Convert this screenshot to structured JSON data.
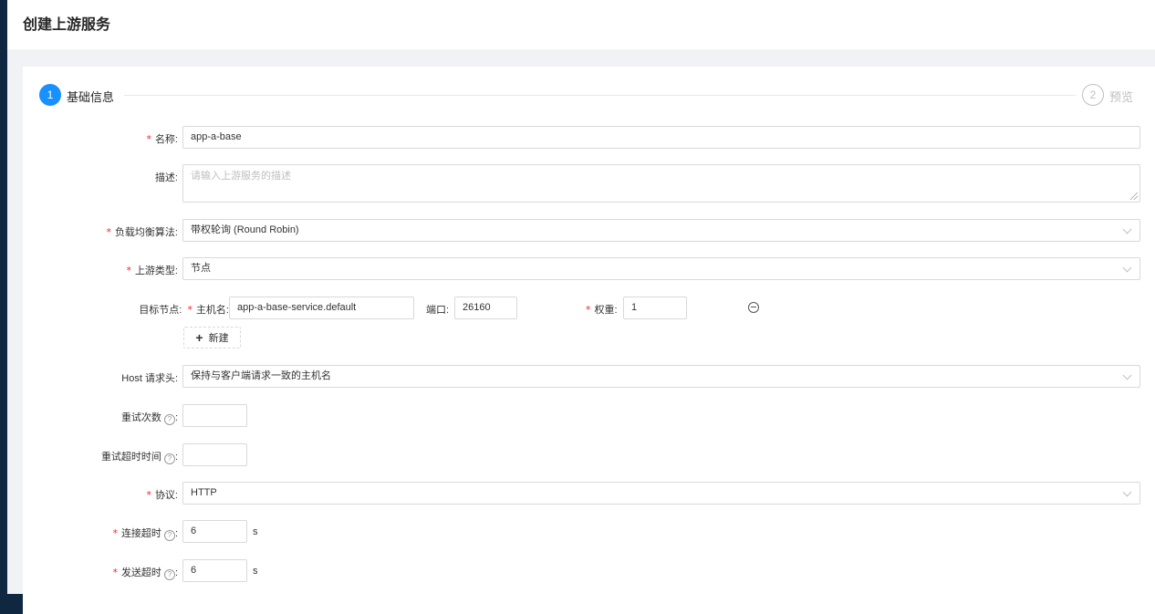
{
  "page": {
    "title": "创建上游服务"
  },
  "steps": [
    {
      "number": "1",
      "title": "基础信息"
    },
    {
      "number": "2",
      "title": "预览"
    }
  ],
  "form": {
    "name": {
      "label": "名称:",
      "value": "app-a-base"
    },
    "description": {
      "label": "描述:",
      "placeholder": "请输入上游服务的描述"
    },
    "algorithm": {
      "label": "负载均衡算法:",
      "value": "带权轮询 (Round Robin)"
    },
    "upstream_type": {
      "label": "上游类型:",
      "value": "节点"
    },
    "target_nodes": {
      "label": "目标节点:",
      "host_label": "主机名:",
      "host_value": "app-a-base-service.default",
      "port_label": "端口:",
      "port_value": "26160",
      "weight_label": "权重:",
      "weight_value": "1",
      "add_label": "新建"
    },
    "host_header": {
      "label": "Host 请求头:",
      "value": "保持与客户端请求一致的主机名"
    },
    "retries": {
      "label": "重试次数",
      "value": ""
    },
    "retry_timeout": {
      "label": "重试超时时间",
      "value": ""
    },
    "protocol": {
      "label": "协议:",
      "value": "HTTP"
    },
    "connect_timeout": {
      "label": "连接超时",
      "value": "6",
      "unit": "s"
    },
    "send_timeout": {
      "label": "发送超时",
      "value": "6",
      "unit": "s"
    }
  },
  "icons": {
    "help": "question-circle-icon",
    "chevron": "chevron-down-icon",
    "remove": "minus-circle-icon",
    "add": "plus-icon"
  },
  "colors": {
    "primary": "#1890ff",
    "required": "#f5222d",
    "sidebar": "#0f2741"
  }
}
